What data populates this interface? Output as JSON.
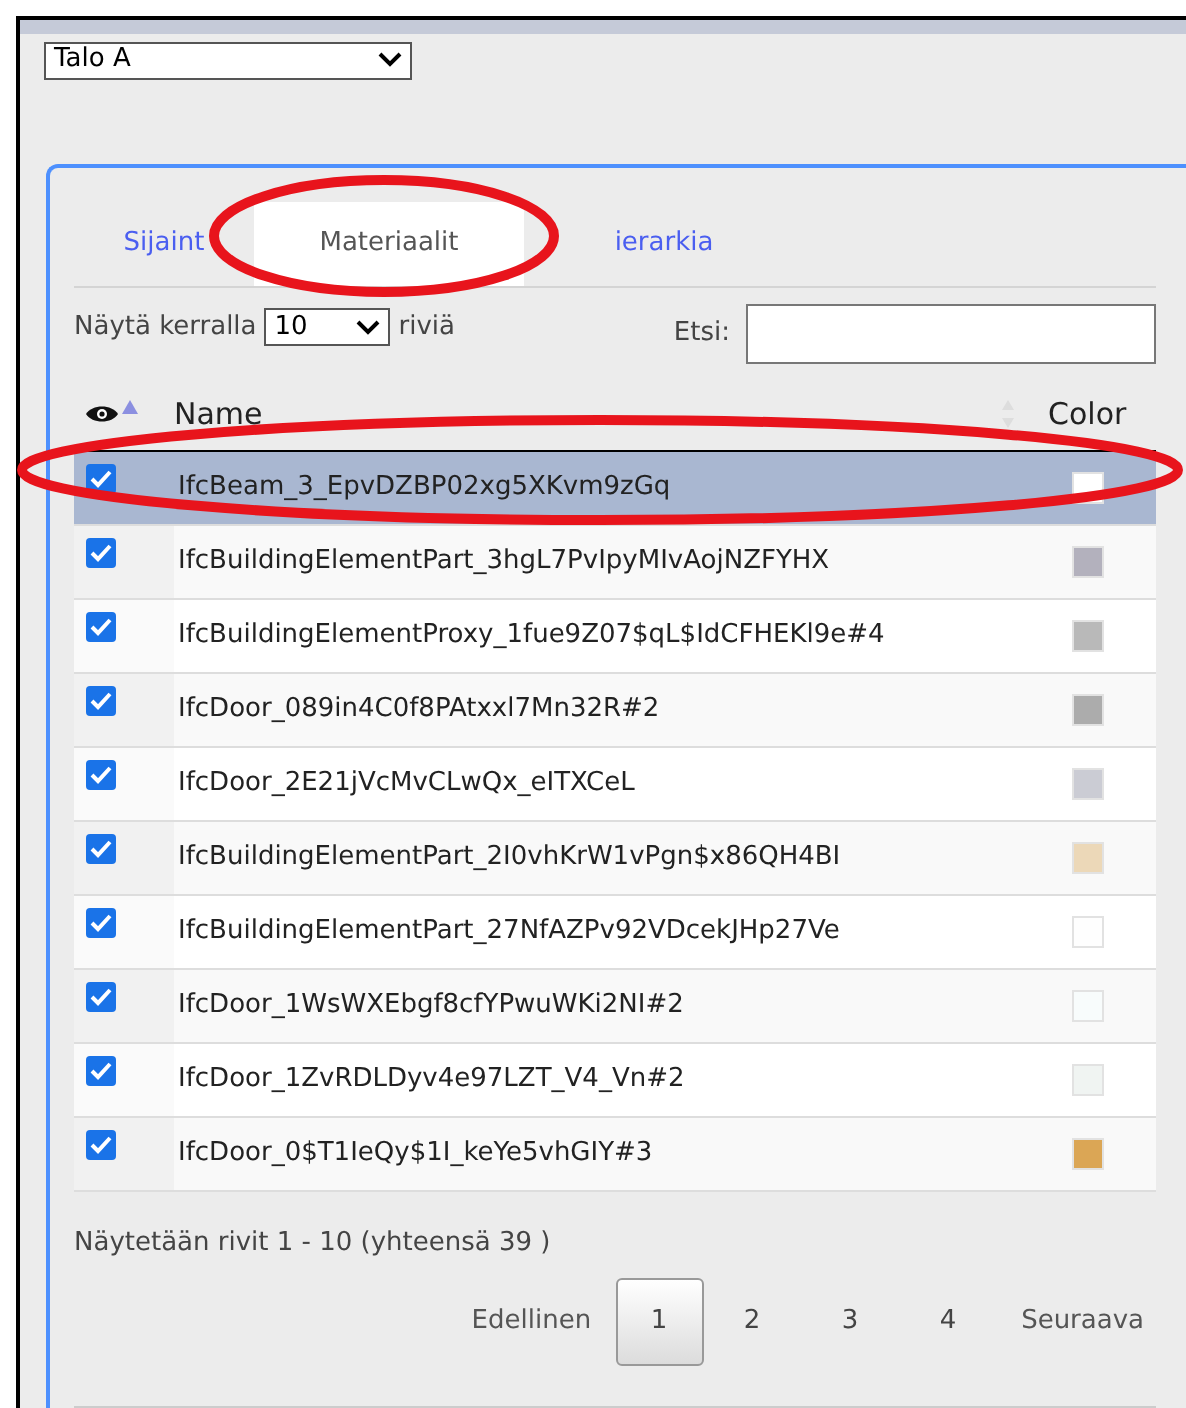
{
  "building_select": {
    "value": "Talo A"
  },
  "tabs": [
    {
      "label": "Sijaint",
      "selected": false
    },
    {
      "label": "Materiaalit",
      "selected": true
    },
    {
      "label": "ierarkia",
      "selected": false
    }
  ],
  "length_control": {
    "prefix": "Näytä kerralla",
    "value": "10",
    "suffix": "riviä"
  },
  "search": {
    "label": "Etsi:"
  },
  "table": {
    "columns": [
      "Name",
      "Color"
    ],
    "rows": [
      {
        "checked": true,
        "selected": true,
        "name": "IfcBeam_3_EpvDZBP02xg5XKvm9zGq",
        "color": "#ffffff"
      },
      {
        "checked": true,
        "selected": false,
        "name": "IfcBuildingElementPart_3hgL7PvIpyMIvAojNZFYHX",
        "color": "#b3b1bd"
      },
      {
        "checked": true,
        "selected": false,
        "name": "IfcBuildingElementProxy_1fue9Z07$qL$IdCFHEKl9e#4",
        "color": "#b9b9b9"
      },
      {
        "checked": true,
        "selected": false,
        "name": "IfcDoor_089in4C0f8PAtxxl7Mn32R#2",
        "color": "#acacac"
      },
      {
        "checked": true,
        "selected": false,
        "name": "IfcDoor_2E21jVcMvCLwQx_eITXCeL",
        "color": "#cbccd4"
      },
      {
        "checked": true,
        "selected": false,
        "name": "IfcBuildingElementPart_2I0vhKrW1vPgn$x86QH4BI",
        "color": "#ecd8b8"
      },
      {
        "checked": true,
        "selected": false,
        "name": "IfcBuildingElementPart_27NfAZPv92VDcekJHp27Ve",
        "color": "#fefefe"
      },
      {
        "checked": true,
        "selected": false,
        "name": "IfcDoor_1WsWXEbgf8cfYPwuWKi2NI#2",
        "color": "#f8fcfc"
      },
      {
        "checked": true,
        "selected": false,
        "name": "IfcDoor_1ZvRDLDyv4e97LZT_V4_Vn#2",
        "color": "#f0f4f2"
      },
      {
        "checked": true,
        "selected": false,
        "name": "IfcDoor_0$T1IeQy$1I_keYe5vhGIY#3",
        "color": "#dba655"
      }
    ]
  },
  "info": "Näytetään rivit 1 - 10 (yhteensä 39 )",
  "pagination": {
    "previous": "Edellinen",
    "pages": [
      {
        "label": "1",
        "selected": true
      },
      {
        "label": "2",
        "selected": false
      },
      {
        "label": "3",
        "selected": false
      },
      {
        "label": "4",
        "selected": false
      }
    ],
    "next": "Seuraava"
  }
}
